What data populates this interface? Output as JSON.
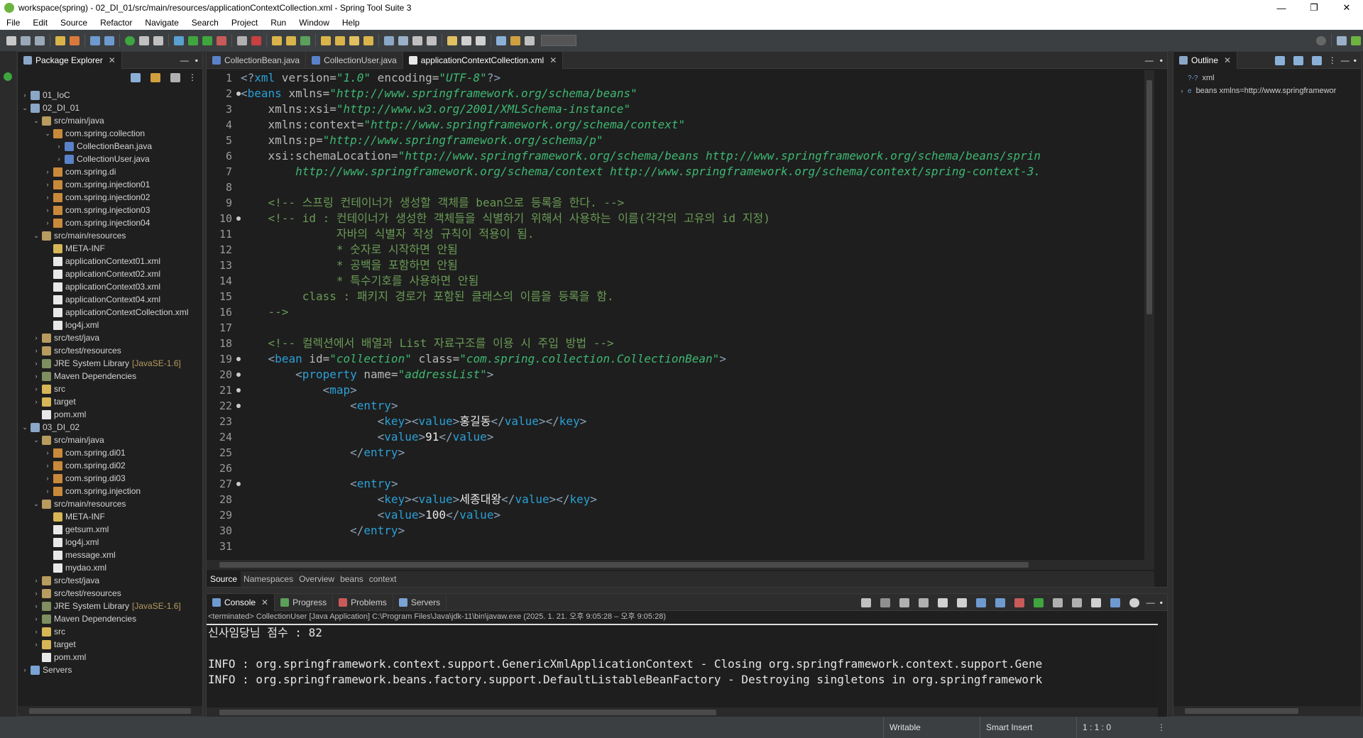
{
  "window": {
    "title": "workspace(spring) - 02_DI_01/src/main/resources/applicationContextCollection.xml - Spring Tool Suite 3",
    "minimize": "—",
    "maximize": "❐",
    "close": "✕"
  },
  "menu": [
    "File",
    "Edit",
    "Source",
    "Refactor",
    "Navigate",
    "Search",
    "Project",
    "Run",
    "Window",
    "Help"
  ],
  "package_explorer": {
    "title": "Package Explorer",
    "close": "✕",
    "rows": [
      {
        "label": "01_IoC",
        "icon": "project-icon",
        "indent": 0,
        "twisty": "›",
        "deco": ""
      },
      {
        "label": "02_DI_01",
        "icon": "project-icon",
        "indent": 0,
        "twisty": "⌄",
        "deco": ""
      },
      {
        "label": "src/main/java",
        "icon": "source-folder-icon",
        "indent": 1,
        "twisty": "⌄",
        "deco": ""
      },
      {
        "label": "com.spring.collection",
        "icon": "package-icon",
        "indent": 2,
        "twisty": "⌄",
        "deco": ""
      },
      {
        "label": "CollectionBean.java",
        "icon": "java-file-icon",
        "indent": 3,
        "twisty": "›",
        "deco": ""
      },
      {
        "label": "CollectionUser.java",
        "icon": "java-file-icon",
        "indent": 3,
        "twisty": "›",
        "deco": ""
      },
      {
        "label": "com.spring.di",
        "icon": "package-icon",
        "indent": 2,
        "twisty": "›",
        "deco": ""
      },
      {
        "label": "com.spring.injection01",
        "icon": "package-icon",
        "indent": 2,
        "twisty": "›",
        "deco": ""
      },
      {
        "label": "com.spring.injection02",
        "icon": "package-icon",
        "indent": 2,
        "twisty": "›",
        "deco": ""
      },
      {
        "label": "com.spring.injection03",
        "icon": "package-icon",
        "indent": 2,
        "twisty": "›",
        "deco": ""
      },
      {
        "label": "com.spring.injection04",
        "icon": "package-icon",
        "indent": 2,
        "twisty": "›",
        "deco": ""
      },
      {
        "label": "src/main/resources",
        "icon": "source-folder-icon",
        "indent": 1,
        "twisty": "⌄",
        "deco": ""
      },
      {
        "label": "META-INF",
        "icon": "folder-icon",
        "indent": 2,
        "twisty": "",
        "deco": ""
      },
      {
        "label": "applicationContext01.xml",
        "icon": "xml-file-icon",
        "indent": 2,
        "twisty": "",
        "deco": ""
      },
      {
        "label": "applicationContext02.xml",
        "icon": "xml-file-icon",
        "indent": 2,
        "twisty": "",
        "deco": ""
      },
      {
        "label": "applicationContext03.xml",
        "icon": "xml-file-icon",
        "indent": 2,
        "twisty": "",
        "deco": ""
      },
      {
        "label": "applicationContext04.xml",
        "icon": "xml-file-icon",
        "indent": 2,
        "twisty": "",
        "deco": ""
      },
      {
        "label": "applicationContextCollection.xml",
        "icon": "xml-file-icon",
        "indent": 2,
        "twisty": "",
        "deco": ""
      },
      {
        "label": "log4j.xml",
        "icon": "xml-file-icon",
        "indent": 2,
        "twisty": "",
        "deco": ""
      },
      {
        "label": "src/test/java",
        "icon": "source-folder-icon",
        "indent": 1,
        "twisty": "›",
        "deco": ""
      },
      {
        "label": "src/test/resources",
        "icon": "source-folder-icon",
        "indent": 1,
        "twisty": "›",
        "deco": ""
      },
      {
        "label": "JRE System Library",
        "icon": "library-icon",
        "indent": 1,
        "twisty": "›",
        "deco": "[JavaSE-1.6]"
      },
      {
        "label": "Maven Dependencies",
        "icon": "library-icon",
        "indent": 1,
        "twisty": "›",
        "deco": ""
      },
      {
        "label": "src",
        "icon": "folder-icon",
        "indent": 1,
        "twisty": "›",
        "deco": ""
      },
      {
        "label": "target",
        "icon": "folder-icon",
        "indent": 1,
        "twisty": "›",
        "deco": ""
      },
      {
        "label": "pom.xml",
        "icon": "xml-file-icon",
        "indent": 1,
        "twisty": "",
        "deco": ""
      },
      {
        "label": "03_DI_02",
        "icon": "project-icon",
        "indent": 0,
        "twisty": "⌄",
        "deco": ""
      },
      {
        "label": "src/main/java",
        "icon": "source-folder-icon",
        "indent": 1,
        "twisty": "⌄",
        "deco": ""
      },
      {
        "label": "com.spring.di01",
        "icon": "package-icon",
        "indent": 2,
        "twisty": "›",
        "deco": ""
      },
      {
        "label": "com.spring.di02",
        "icon": "package-icon",
        "indent": 2,
        "twisty": "›",
        "deco": ""
      },
      {
        "label": "com.spring.di03",
        "icon": "package-icon",
        "indent": 2,
        "twisty": "›",
        "deco": ""
      },
      {
        "label": "com.spring.injection",
        "icon": "package-icon",
        "indent": 2,
        "twisty": "›",
        "deco": ""
      },
      {
        "label": "src/main/resources",
        "icon": "source-folder-icon",
        "indent": 1,
        "twisty": "⌄",
        "deco": ""
      },
      {
        "label": "META-INF",
        "icon": "folder-icon",
        "indent": 2,
        "twisty": "",
        "deco": ""
      },
      {
        "label": "getsum.xml",
        "icon": "xml-file-icon",
        "indent": 2,
        "twisty": "",
        "deco": ""
      },
      {
        "label": "log4j.xml",
        "icon": "xml-file-icon",
        "indent": 2,
        "twisty": "",
        "deco": ""
      },
      {
        "label": "message.xml",
        "icon": "xml-file-icon",
        "indent": 2,
        "twisty": "",
        "deco": ""
      },
      {
        "label": "mydao.xml",
        "icon": "xml-file-icon",
        "indent": 2,
        "twisty": "",
        "deco": ""
      },
      {
        "label": "src/test/java",
        "icon": "source-folder-icon",
        "indent": 1,
        "twisty": "›",
        "deco": ""
      },
      {
        "label": "src/test/resources",
        "icon": "source-folder-icon",
        "indent": 1,
        "twisty": "›",
        "deco": ""
      },
      {
        "label": "JRE System Library",
        "icon": "library-icon",
        "indent": 1,
        "twisty": "›",
        "deco": "[JavaSE-1.6]"
      },
      {
        "label": "Maven Dependencies",
        "icon": "library-icon",
        "indent": 1,
        "twisty": "›",
        "deco": ""
      },
      {
        "label": "src",
        "icon": "folder-icon",
        "indent": 1,
        "twisty": "›",
        "deco": ""
      },
      {
        "label": "target",
        "icon": "folder-icon",
        "indent": 1,
        "twisty": "›",
        "deco": ""
      },
      {
        "label": "pom.xml",
        "icon": "xml-file-icon",
        "indent": 1,
        "twisty": "",
        "deco": ""
      },
      {
        "label": "Servers",
        "icon": "servers-icon",
        "indent": 0,
        "twisty": "›",
        "deco": ""
      }
    ]
  },
  "editor": {
    "tabs": [
      {
        "label": "CollectionBean.java",
        "icon": "java-file-icon",
        "active": false
      },
      {
        "label": "CollectionUser.java",
        "icon": "java-file-icon",
        "active": false
      },
      {
        "label": "applicationContextCollection.xml",
        "icon": "xml-file-icon",
        "active": true
      }
    ],
    "tab_close": "✕",
    "lines": [
      {
        "n": "1",
        "fold": false,
        "segs": [
          {
            "c": "br",
            "t": "<?"
          },
          {
            "c": "tag",
            "t": "xml"
          },
          {
            "c": "attr",
            "t": " version="
          },
          {
            "c": "val",
            "t": "\"1.0\""
          },
          {
            "c": "attr",
            "t": " encoding="
          },
          {
            "c": "val",
            "t": "\"UTF-8\""
          },
          {
            "c": "br",
            "t": "?>"
          }
        ]
      },
      {
        "n": "2",
        "fold": true,
        "segs": [
          {
            "c": "br",
            "t": "<"
          },
          {
            "c": "tag",
            "t": "beans"
          },
          {
            "c": "attr",
            "t": " xmlns="
          },
          {
            "c": "val",
            "t": "\"http://www.springframework.org/schema/beans\""
          }
        ]
      },
      {
        "n": "3",
        "fold": false,
        "segs": [
          {
            "c": "attr",
            "t": "    xmlns:xsi="
          },
          {
            "c": "val",
            "t": "\"http://www.w3.org/2001/XMLSchema-instance\""
          }
        ]
      },
      {
        "n": "4",
        "fold": false,
        "segs": [
          {
            "c": "attr",
            "t": "    xmlns:context="
          },
          {
            "c": "val",
            "t": "\"http://www.springframework.org/schema/context\""
          }
        ]
      },
      {
        "n": "5",
        "fold": false,
        "segs": [
          {
            "c": "attr",
            "t": "    xmlns:p="
          },
          {
            "c": "val",
            "t": "\"http://www.springframework.org/schema/p\""
          }
        ]
      },
      {
        "n": "6",
        "fold": false,
        "segs": [
          {
            "c": "attr",
            "t": "    xsi:schemaLocation="
          },
          {
            "c": "val",
            "t": "\"http://www.springframework.org/schema/beans http://www.springframework.org/schema/beans/sprin"
          }
        ]
      },
      {
        "n": "7",
        "fold": false,
        "segs": [
          {
            "c": "val",
            "t": "        http://www.springframework.org/schema/context http://www.springframework.org/schema/context/spring-context-3."
          }
        ]
      },
      {
        "n": "8",
        "fold": false,
        "segs": [
          {
            "c": "txt",
            "t": ""
          }
        ]
      },
      {
        "n": "9",
        "fold": false,
        "segs": [
          {
            "c": "com",
            "t": "    <!-- 스프링 컨테이너가 생성할 객체를 bean으로 등록을 한다. -->"
          }
        ]
      },
      {
        "n": "10",
        "fold": true,
        "segs": [
          {
            "c": "com",
            "t": "    <!-- id : 컨테이너가 생성한 객체들을 식별하기 위해서 사용하는 이름(각각의 고유의 id 지정)"
          }
        ]
      },
      {
        "n": "11",
        "fold": false,
        "segs": [
          {
            "c": "com",
            "t": "              자바의 식별자 작성 규칙이 적용이 됨."
          }
        ]
      },
      {
        "n": "12",
        "fold": false,
        "segs": [
          {
            "c": "com",
            "t": "              * 숫자로 시작하면 안됨"
          }
        ]
      },
      {
        "n": "13",
        "fold": false,
        "segs": [
          {
            "c": "com",
            "t": "              * 공백을 포함하면 안됨"
          }
        ]
      },
      {
        "n": "14",
        "fold": false,
        "segs": [
          {
            "c": "com",
            "t": "              * 특수기호를 사용하면 안됨"
          }
        ]
      },
      {
        "n": "15",
        "fold": false,
        "segs": [
          {
            "c": "com",
            "t": "         class : 패키지 경로가 포함된 클래스의 이름을 등록을 함."
          }
        ]
      },
      {
        "n": "16",
        "fold": false,
        "segs": [
          {
            "c": "com",
            "t": "    -->"
          }
        ]
      },
      {
        "n": "17",
        "fold": false,
        "segs": [
          {
            "c": "txt",
            "t": ""
          }
        ]
      },
      {
        "n": "18",
        "fold": false,
        "segs": [
          {
            "c": "com",
            "t": "    <!-- 컬렉션에서 배열과 List 자료구조를 이용 시 주입 방법 -->"
          }
        ]
      },
      {
        "n": "19",
        "fold": true,
        "segs": [
          {
            "c": "br",
            "t": "    <"
          },
          {
            "c": "tag",
            "t": "bean"
          },
          {
            "c": "attr",
            "t": " id="
          },
          {
            "c": "val",
            "t": "\"collection\""
          },
          {
            "c": "attr",
            "t": " class="
          },
          {
            "c": "val",
            "t": "\"com.spring.collection.CollectionBean\""
          },
          {
            "c": "br",
            "t": ">"
          }
        ]
      },
      {
        "n": "20",
        "fold": true,
        "segs": [
          {
            "c": "br",
            "t": "        <"
          },
          {
            "c": "tag",
            "t": "property"
          },
          {
            "c": "attr",
            "t": " name="
          },
          {
            "c": "val",
            "t": "\"addressList\""
          },
          {
            "c": "br",
            "t": ">"
          }
        ]
      },
      {
        "n": "21",
        "fold": true,
        "segs": [
          {
            "c": "br",
            "t": "            <"
          },
          {
            "c": "tag",
            "t": "map"
          },
          {
            "c": "br",
            "t": ">"
          }
        ]
      },
      {
        "n": "22",
        "fold": true,
        "segs": [
          {
            "c": "br",
            "t": "                <"
          },
          {
            "c": "tag",
            "t": "entry"
          },
          {
            "c": "br",
            "t": ">"
          }
        ]
      },
      {
        "n": "23",
        "fold": false,
        "segs": [
          {
            "c": "br",
            "t": "                    <"
          },
          {
            "c": "tag",
            "t": "key"
          },
          {
            "c": "br",
            "t": "><"
          },
          {
            "c": "tag",
            "t": "value"
          },
          {
            "c": "br",
            "t": ">"
          },
          {
            "c": "txt",
            "t": "홍길동"
          },
          {
            "c": "br",
            "t": "</"
          },
          {
            "c": "tag",
            "t": "value"
          },
          {
            "c": "br",
            "t": "></"
          },
          {
            "c": "tag",
            "t": "key"
          },
          {
            "c": "br",
            "t": ">"
          }
        ]
      },
      {
        "n": "24",
        "fold": false,
        "segs": [
          {
            "c": "br",
            "t": "                    <"
          },
          {
            "c": "tag",
            "t": "value"
          },
          {
            "c": "br",
            "t": ">"
          },
          {
            "c": "txt",
            "t": "91"
          },
          {
            "c": "br",
            "t": "</"
          },
          {
            "c": "tag",
            "t": "value"
          },
          {
            "c": "br",
            "t": ">"
          }
        ]
      },
      {
        "n": "25",
        "fold": false,
        "segs": [
          {
            "c": "br",
            "t": "                </"
          },
          {
            "c": "tag",
            "t": "entry"
          },
          {
            "c": "br",
            "t": ">"
          }
        ]
      },
      {
        "n": "26",
        "fold": false,
        "segs": [
          {
            "c": "txt",
            "t": ""
          }
        ]
      },
      {
        "n": "27",
        "fold": true,
        "segs": [
          {
            "c": "br",
            "t": "                <"
          },
          {
            "c": "tag",
            "t": "entry"
          },
          {
            "c": "br",
            "t": ">"
          }
        ]
      },
      {
        "n": "28",
        "fold": false,
        "segs": [
          {
            "c": "br",
            "t": "                    <"
          },
          {
            "c": "tag",
            "t": "key"
          },
          {
            "c": "br",
            "t": "><"
          },
          {
            "c": "tag",
            "t": "value"
          },
          {
            "c": "br",
            "t": ">"
          },
          {
            "c": "txt",
            "t": "세종대왕"
          },
          {
            "c": "br",
            "t": "</"
          },
          {
            "c": "tag",
            "t": "value"
          },
          {
            "c": "br",
            "t": "></"
          },
          {
            "c": "tag",
            "t": "key"
          },
          {
            "c": "br",
            "t": ">"
          }
        ]
      },
      {
        "n": "29",
        "fold": false,
        "segs": [
          {
            "c": "br",
            "t": "                    <"
          },
          {
            "c": "tag",
            "t": "value"
          },
          {
            "c": "br",
            "t": ">"
          },
          {
            "c": "txt",
            "t": "100"
          },
          {
            "c": "br",
            "t": "</"
          },
          {
            "c": "tag",
            "t": "value"
          },
          {
            "c": "br",
            "t": ">"
          }
        ]
      },
      {
        "n": "30",
        "fold": false,
        "segs": [
          {
            "c": "br",
            "t": "                </"
          },
          {
            "c": "tag",
            "t": "entry"
          },
          {
            "c": "br",
            "t": ">"
          }
        ]
      },
      {
        "n": "31",
        "fold": false,
        "segs": [
          {
            "c": "txt",
            "t": ""
          }
        ]
      }
    ],
    "bottom_tabs": [
      "Source",
      "Namespaces",
      "Overview",
      "beans",
      "context"
    ]
  },
  "outline": {
    "title": "Outline",
    "close": "✕",
    "rows": [
      {
        "label": "xml",
        "prefix": "?-?",
        "twisty": ""
      },
      {
        "label": "beans xmlns=http://www.springframewor",
        "prefix": "e",
        "twisty": "›"
      }
    ]
  },
  "console": {
    "tabs": [
      {
        "label": "Console",
        "icon": "console-icon",
        "active": true
      },
      {
        "label": "Progress",
        "icon": "progress-icon",
        "active": false
      },
      {
        "label": "Problems",
        "icon": "problems-icon",
        "active": false
      },
      {
        "label": "Servers",
        "icon": "servers-icon",
        "active": false
      }
    ],
    "tab_close": "✕",
    "terminated": "<terminated> CollectionUser [Java Application] C:\\Program Files\\Java\\jdk-11\\bin\\javaw.exe  (2025. 1. 21. 오후 9:05:28 – 오후 9:05:28)",
    "output": [
      "신사임당님 점수 : 82",
      "",
      "INFO : org.springframework.context.support.GenericXmlApplicationContext - Closing org.springframework.context.support.Gene",
      "INFO : org.springframework.beans.factory.support.DefaultListableBeanFactory - Destroying singletons in org.springframework"
    ]
  },
  "status": {
    "writable": "Writable",
    "insert_mode": "Smart Insert",
    "position": "1 : 1 : 0"
  },
  "colors": {
    "tag": "#2aa0d6",
    "attr": "#b8b8b8",
    "value": "#3fb872",
    "comment": "#6a9a55",
    "background": "#1e1e1e"
  }
}
